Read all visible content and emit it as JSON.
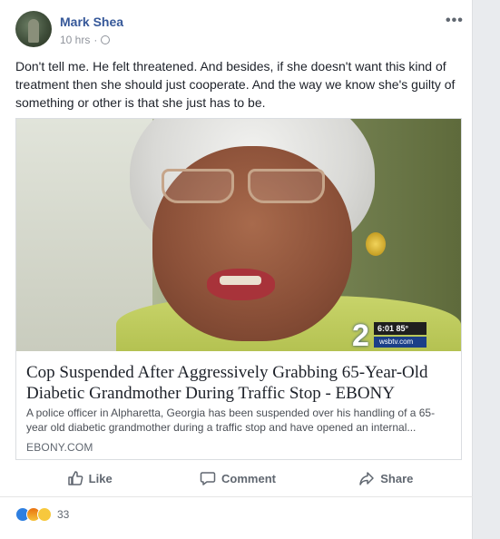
{
  "post": {
    "author": "Mark Shea",
    "time": "10 hrs",
    "separator": "·",
    "more": "•••",
    "text": "Don't tell me. He felt threatened. And besides, if she doesn't want this kind of treatment then she should just cooperate. And the way we know she's guilty of something or other is that she just has to be."
  },
  "link": {
    "overlay": {
      "channel": "2",
      "time": "6:01",
      "temp": "85°",
      "site": "wsbtv.com"
    },
    "title": "Cop Suspended After Aggressively Grabbing 65-Year-Old Diabetic Grandmother During Traffic Stop - EBONY",
    "description": "A police officer in Alpharetta, Georgia has been suspended over his handling of a 65-year old diabetic grandmother during a traffic stop and have opened an internal...",
    "domain": "EBONY.COM"
  },
  "actions": {
    "like": "Like",
    "comment": "Comment",
    "share": "Share"
  },
  "reactions": {
    "icons": [
      "like-reaction",
      "angry-reaction",
      "sad-reaction"
    ],
    "count": "33"
  },
  "colors": {
    "author": "#365899",
    "like": "#2e7fe0"
  }
}
